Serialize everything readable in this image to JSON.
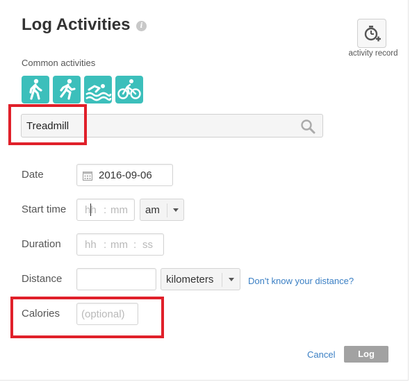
{
  "header": {
    "title": "Log Activities",
    "info_icon": "info-icon"
  },
  "activity_record": {
    "label": "activity record",
    "icon": "stopwatch-plus-icon"
  },
  "common_activities": {
    "label": "Common activities",
    "items": [
      {
        "name": "walking",
        "icon": "walking-icon"
      },
      {
        "name": "running",
        "icon": "running-icon"
      },
      {
        "name": "swimming",
        "icon": "swimming-icon"
      },
      {
        "name": "cycling",
        "icon": "cycling-icon"
      }
    ]
  },
  "search": {
    "value": "Treadmill",
    "icon": "search-icon"
  },
  "form": {
    "date": {
      "label": "Date",
      "value": "2016-09-06"
    },
    "start_time": {
      "label": "Start time",
      "hour_placeholder": "hh",
      "min_placeholder": "mm",
      "separator": ":",
      "ampm": "am"
    },
    "duration": {
      "label": "Duration",
      "hh": "hh",
      "mm": "mm",
      "ss": "ss",
      "separator": ":"
    },
    "distance": {
      "label": "Distance",
      "unit": "kilometers",
      "help_link": "Don't know your distance?"
    },
    "calories": {
      "label": "Calories",
      "placeholder": "(optional)"
    }
  },
  "actions": {
    "cancel": "Cancel",
    "log": "Log"
  },
  "colors": {
    "activity_teal": "#3cbfbb",
    "link_blue": "#3a7fc4",
    "highlight_red": "#e0202a",
    "log_button": "#a2a2a2"
  }
}
